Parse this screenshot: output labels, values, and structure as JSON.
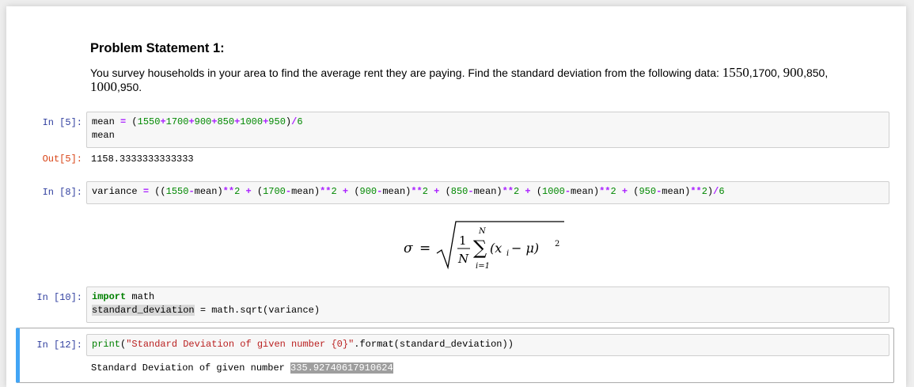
{
  "markdown": {
    "title": "Problem Statement 1:",
    "text_parts": [
      "You survey households in your area to find the average rent they are paying. Find the standard deviation from the following data: ",
      "1550",
      ",1700, ",
      "900",
      ",850, ",
      "1000",
      ",950."
    ]
  },
  "cells": {
    "c5": {
      "prompt": "In [5]:",
      "line1": [
        "mean ",
        "=",
        " (",
        "1550",
        "+",
        "1700",
        "+",
        "900",
        "+",
        "850",
        "+",
        "1000",
        "+",
        "950",
        ")",
        "/",
        "6"
      ],
      "line2": "mean",
      "out_prompt": "Out[5]:",
      "output": "1158.3333333333333"
    },
    "c8": {
      "prompt": "In [8]:",
      "parts": [
        "variance ",
        "=",
        " ((",
        "1550",
        "-",
        "mean)",
        "**",
        "2",
        " ",
        "+",
        " (",
        "1700",
        "-",
        "mean)",
        "**",
        "2",
        " ",
        "+",
        " (",
        "900",
        "-",
        "mean)",
        "**",
        "2",
        " ",
        "+",
        " (",
        "850",
        "-",
        "mean)",
        "**",
        "2",
        " ",
        "+",
        " (",
        "1000",
        "-",
        "mean)",
        "**",
        "2",
        " ",
        "+",
        " (",
        "950",
        "-",
        "mean)",
        "**",
        "2",
        ")",
        "/",
        "6"
      ]
    },
    "formula": {
      "sigma": "σ",
      "equals": "=",
      "one": "1",
      "n_den": "N",
      "n_top": "N",
      "sum": "∑",
      "body": "(x",
      "sub_i": "i",
      "minus_mu": " − μ)",
      "sq": "2",
      "lower": "i=1"
    },
    "c10": {
      "prompt": "In [10]:",
      "line1_kw": "import",
      "line1_mod": " math",
      "line2_sel": "standard_deviation",
      "line2_rest_a": " = ",
      "line2_rest_b": "math.sqrt(variance)"
    },
    "c12": {
      "prompt": "In [12]:",
      "print_fn": "print",
      "paren_open": "(",
      "string": "\"Standard Deviation of given number {0}\"",
      "rest": ".format(standard_deviation))",
      "output_label": "Standard Deviation of given number ",
      "output_value": "335.92740617910624"
    }
  }
}
